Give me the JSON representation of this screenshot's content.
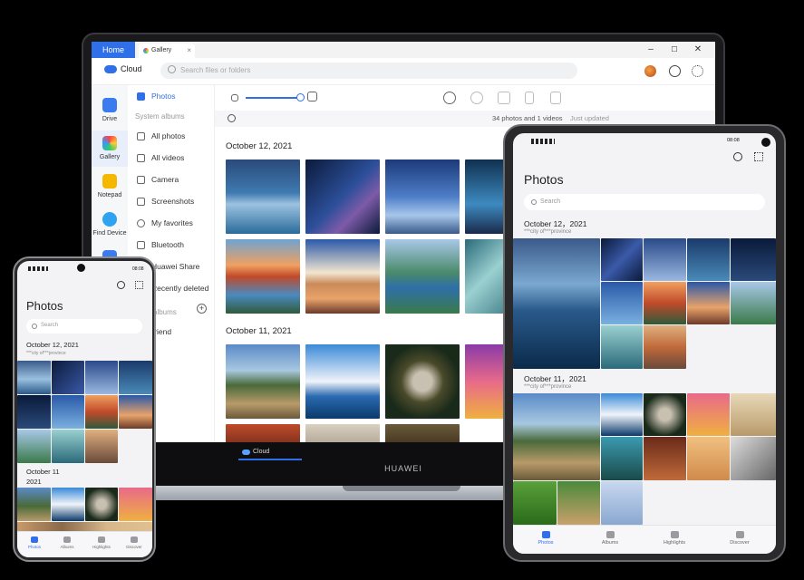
{
  "window": {
    "home_tab": "Home",
    "gallery_tab": "Gallery",
    "close_glyph": "×",
    "minimize_glyph": "–",
    "maximize_glyph": "☐",
    "window_close_glyph": "✕"
  },
  "app": {
    "name": "Cloud",
    "search_placeholder": "Search files or folders"
  },
  "leftnav": {
    "items": [
      {
        "label": "Drive",
        "color": "#3a7bf0"
      },
      {
        "label": "Gallery",
        "color": "#f2a93b"
      },
      {
        "label": "Notepad",
        "color": "#f5b800"
      },
      {
        "label": "Find Device",
        "color": "#2fa3f0"
      }
    ]
  },
  "sidebar": {
    "active": "Photos",
    "system_albums_label": "System albums",
    "items": [
      "All photos",
      "All videos",
      "Camera",
      "Screenshots",
      "My favorites",
      "Bluetooth",
      "Huawei Share",
      "Recently deleted"
    ],
    "albums_label": "albums",
    "albums_add": "+",
    "friend_label": "Friend"
  },
  "status": {
    "summary": "34 photos and 1 videos",
    "sync": "Just updated"
  },
  "gallery": {
    "date1": "October 12, 2021",
    "date2": "October 11, 2021"
  },
  "taskbar": {
    "app_label": "Cloud",
    "brand": "HUAWEI"
  },
  "tablet": {
    "time": "08:08",
    "title": "Photos",
    "search_placeholder": "Search",
    "date1": "October 12，2021",
    "loc1": "***city  of***province",
    "date2": "October 11，2021",
    "loc2": "***city  of***province",
    "nav": [
      "Photos",
      "Albums",
      "Highlights",
      "Discover"
    ]
  },
  "phone": {
    "time": "08:08",
    "title": "Photos",
    "search_placeholder": "Search",
    "date1": "October 12, 2021",
    "loc1": "***city  of***province",
    "date2a": "October 11",
    "date2b": "2021",
    "nav": [
      "Photos",
      "Albums",
      "Highlights",
      "Discover"
    ]
  },
  "colors": {
    "accent": "#2f6fe8"
  }
}
